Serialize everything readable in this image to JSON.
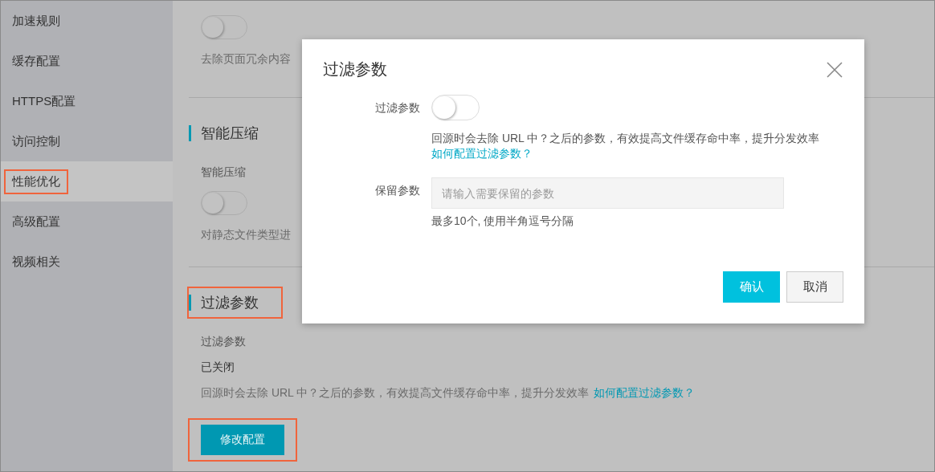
{
  "sidebar": {
    "items": [
      {
        "label": "加速规则",
        "selected": false,
        "highlighted": false
      },
      {
        "label": "缓存配置",
        "selected": false,
        "highlighted": false
      },
      {
        "label": "HTTPS配置",
        "selected": false,
        "highlighted": false
      },
      {
        "label": "访问控制",
        "selected": false,
        "highlighted": false
      },
      {
        "label": "性能优化",
        "selected": true,
        "highlighted": true
      },
      {
        "label": "高级配置",
        "selected": false,
        "highlighted": false
      },
      {
        "label": "视频相关",
        "selected": false,
        "highlighted": false
      }
    ]
  },
  "content": {
    "blocks": [
      {
        "toggle_on": false,
        "description": "去除页面冗余内容"
      },
      {
        "title": "智能压缩",
        "highlighted": false,
        "label": "智能压缩",
        "toggle_on": false,
        "description": "对静态文件类型进"
      },
      {
        "title": "过滤参数",
        "highlighted": true,
        "label": "过滤参数",
        "status": "已关闭",
        "description": "回源时会去除 URL 中？之后的参数，有效提高文件缓存命中率，提升分发效率",
        "link": "如何配置过滤参数？",
        "button": {
          "label": "修改配置",
          "highlighted": true
        }
      }
    ]
  },
  "modal": {
    "title": "过滤参数",
    "fields": [
      {
        "kind": "switch",
        "label": "过滤参数",
        "on": false,
        "help": "回源时会去除 URL 中？之后的参数，有效提高文件缓存命中率，提升分发效率",
        "link": "如何配置过滤参数？"
      },
      {
        "kind": "input",
        "label": "保留参数",
        "placeholder": "请输入需要保留的参数",
        "help": "最多10个, 使用半角逗号分隔"
      }
    ],
    "buttons": [
      {
        "label": "确认",
        "kind": "primary"
      },
      {
        "label": "取消",
        "kind": "secondary"
      }
    ]
  }
}
